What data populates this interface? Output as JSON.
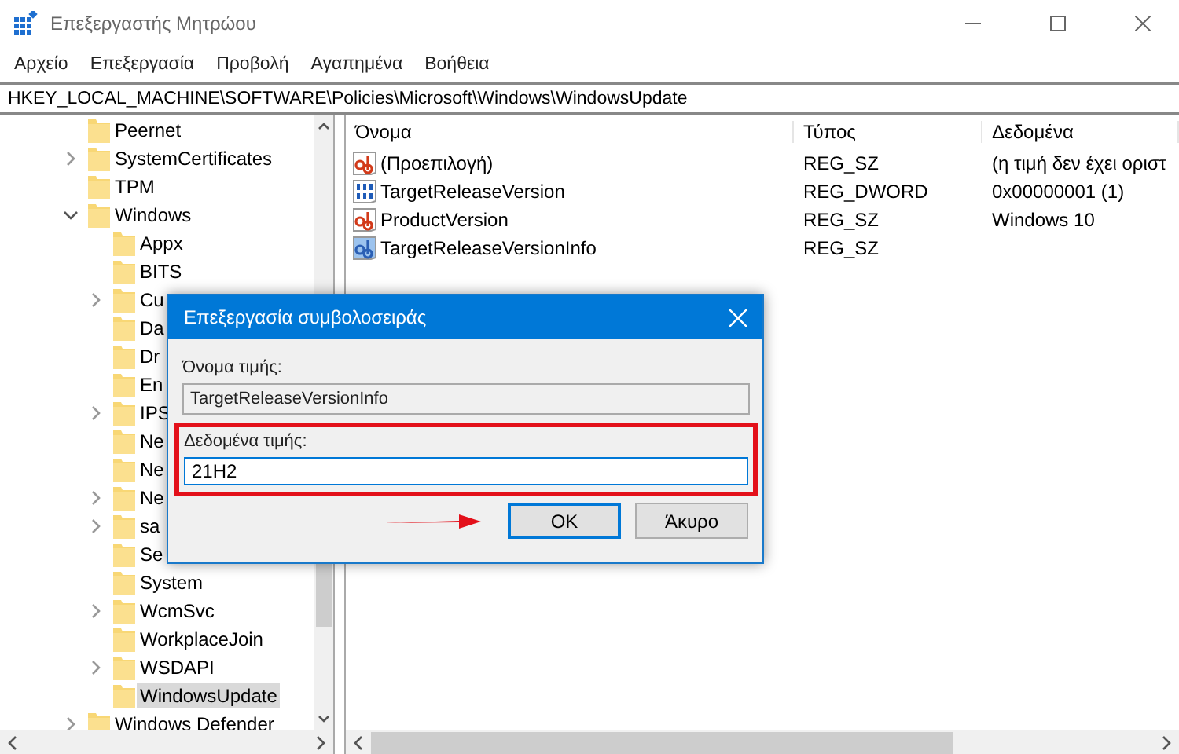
{
  "window": {
    "title": "Επεξεργαστής Μητρώου"
  },
  "menu": [
    "Αρχείο",
    "Επεξεργασία",
    "Προβολή",
    "Αγαπημένα",
    "Βοήθεια"
  ],
  "address": "HKEY_LOCAL_MACHINE\\SOFTWARE\\Policies\\Microsoft\\Windows\\WindowsUpdate",
  "tree": [
    {
      "label": "Peernet",
      "kind": "leaf",
      "selected": false
    },
    {
      "label": "SystemCertificates",
      "kind": "folder",
      "expanded": false,
      "selected": false
    },
    {
      "label": "TPM",
      "kind": "leaf",
      "selected": false
    },
    {
      "label": "Windows",
      "kind": "folder",
      "expanded": true,
      "selected": false,
      "children": [
        {
          "label": "Appx",
          "kind": "leaf",
          "selected": false
        },
        {
          "label": "BITS",
          "kind": "leaf",
          "selected": false
        },
        {
          "label": "Cu",
          "kind": "folder",
          "expanded": false,
          "selected": false
        },
        {
          "label": "Da",
          "kind": "leaf",
          "selected": false
        },
        {
          "label": "Dr",
          "kind": "leaf",
          "selected": false
        },
        {
          "label": "En",
          "kind": "leaf",
          "selected": false
        },
        {
          "label": "IPS",
          "kind": "folder",
          "expanded": false,
          "selected": false
        },
        {
          "label": "Ne",
          "kind": "leaf",
          "selected": false
        },
        {
          "label": "Ne",
          "kind": "leaf",
          "selected": false
        },
        {
          "label": "Ne",
          "kind": "folder",
          "expanded": false,
          "selected": false
        },
        {
          "label": "sa",
          "kind": "folder",
          "expanded": false,
          "selected": false
        },
        {
          "label": "Se",
          "kind": "leaf",
          "selected": false
        },
        {
          "label": "System",
          "kind": "leaf",
          "selected": false
        },
        {
          "label": "WcmSvc",
          "kind": "folder",
          "expanded": false,
          "selected": false
        },
        {
          "label": "WorkplaceJoin",
          "kind": "leaf",
          "selected": false
        },
        {
          "label": "WSDAPI",
          "kind": "folder",
          "expanded": false,
          "selected": false
        },
        {
          "label": "WindowsUpdate",
          "kind": "leaf",
          "selected": true
        }
      ]
    },
    {
      "label": "Windows Defender",
      "kind": "folder",
      "expanded": false,
      "selected": false
    }
  ],
  "table": {
    "columns": [
      "Όνομα",
      "Τύπος",
      "Δεδομένα"
    ],
    "rows": [
      {
        "name": "(Προεπιλογή)",
        "type": "REG_SZ",
        "data": "(η τιμή δεν έχει οριστ",
        "kind": "string",
        "selected": false
      },
      {
        "name": "TargetReleaseVersion",
        "type": "REG_DWORD",
        "data": "0x00000001 (1)",
        "kind": "dword",
        "selected": false
      },
      {
        "name": "ProductVersion",
        "type": "REG_SZ",
        "data": "Windows 10",
        "kind": "string",
        "selected": false
      },
      {
        "name": "TargetReleaseVersionInfo",
        "type": "REG_SZ",
        "kind": "string",
        "selected": true
      }
    ]
  },
  "dialog": {
    "title": "Επεξεργασία συμβολοσειράς",
    "name_label": "Όνομα τιμής:",
    "name_value": "TargetReleaseVersionInfo",
    "data_label": "Δεδομένα τιμής:",
    "data_value": "21H2",
    "buttons": [
      {
        "label": "OK",
        "selected": true
      },
      {
        "label": "Άκυρο",
        "selected": false
      }
    ]
  }
}
